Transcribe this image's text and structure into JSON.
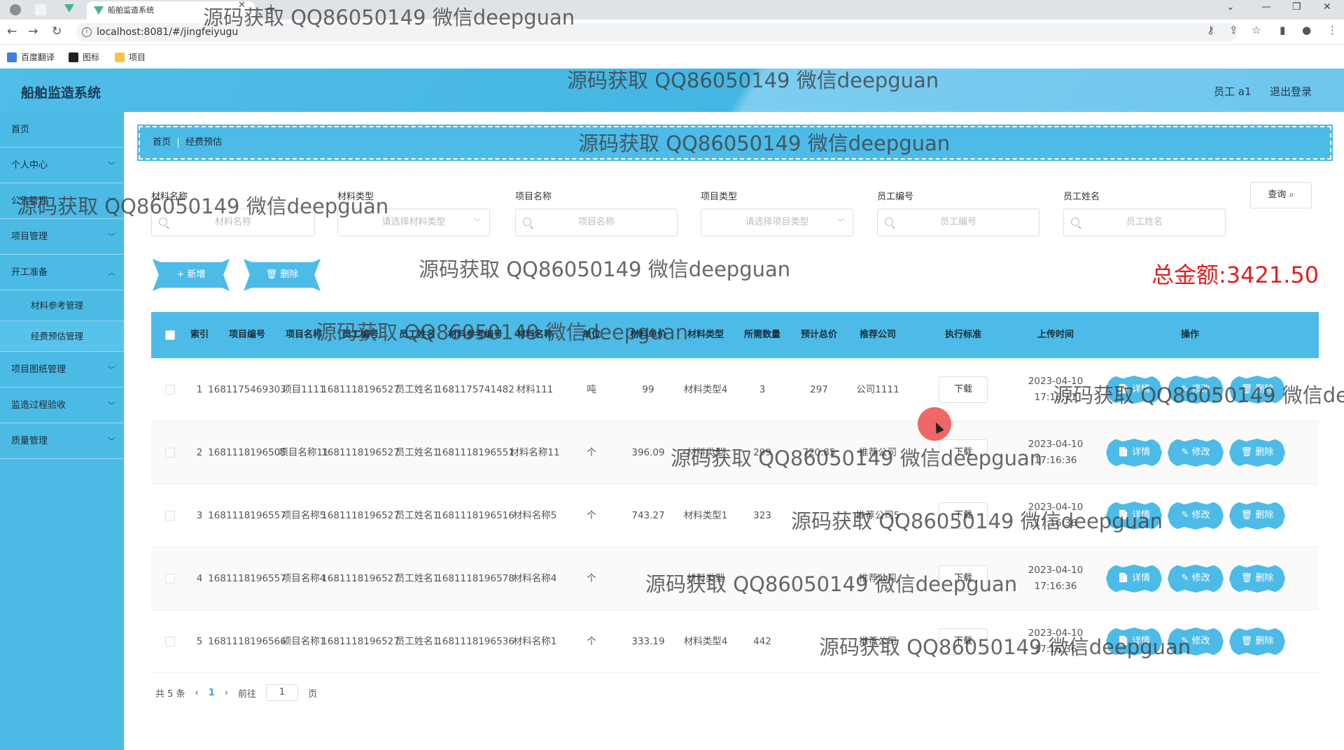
{
  "browser": {
    "tab_title": "船舶监造系统",
    "url": "localhost:8081/#/jingfeiyugu",
    "bookmarks": [
      "百度翻译",
      "图标",
      "项目"
    ]
  },
  "header": {
    "brand": "船舶监造系统",
    "user": "员工 a1",
    "logout": "退出登录"
  },
  "sidebar": {
    "items": [
      {
        "label": "首页",
        "chevron": false
      },
      {
        "label": "个人中心",
        "chevron": true
      },
      {
        "label": "公告管理",
        "chevron": true
      },
      {
        "label": "项目管理",
        "chevron": true
      },
      {
        "label": "开工准备",
        "chevron": true
      },
      {
        "label": "材料参考管理",
        "sub": true
      },
      {
        "label": "经费预估管理",
        "sub": true,
        "active": true
      },
      {
        "label": "项目图纸管理",
        "chevron": true
      },
      {
        "label": "监造过程验收",
        "chevron": true
      },
      {
        "label": "质量管理",
        "chevron": true
      }
    ]
  },
  "breadcrumb": {
    "home": "首页",
    "current": "经费预估"
  },
  "search": {
    "fields": [
      {
        "label": "材料名称",
        "placeholder": "材料名称",
        "type": "text"
      },
      {
        "label": "材料类型",
        "placeholder": "请选择材料类型",
        "type": "select"
      },
      {
        "label": "项目名称",
        "placeholder": "项目名称",
        "type": "text"
      },
      {
        "label": "项目类型",
        "placeholder": "请选择项目类型",
        "type": "select"
      },
      {
        "label": "员工编号",
        "placeholder": "员工编号",
        "type": "text"
      },
      {
        "label": "员工姓名",
        "placeholder": "员工姓名",
        "type": "text"
      }
    ],
    "query_label": "查询"
  },
  "actions": {
    "add": "+ 新增",
    "delete": "删除"
  },
  "total": "总金额:3421.50",
  "table": {
    "headers": [
      "索引",
      "项目编号",
      "项目名称",
      "员工编号",
      "员工姓名",
      "材料参考编号",
      "材料名称",
      "单位",
      "材料单价",
      "材料类型",
      "所需数量",
      "预计总价",
      "推荐公司",
      "执行标准",
      "上传时间",
      "操作"
    ],
    "download_label": "下载",
    "op_labels": {
      "detail": "详情",
      "edit": "修改",
      "delete": "删除"
    },
    "rows": [
      {
        "index": "1",
        "project_no": "1681175469303",
        "project_name": "项目1111",
        "staff_no": "1681118196527",
        "staff_name": "员工姓名1",
        "ref_no": "1681175741482",
        "material_name": "材料111",
        "unit": "吨",
        "price": "99",
        "material_type": "材料类型4",
        "qty": "3",
        "total": "297",
        "company": "公司1111",
        "time": "2023-04-10 17:16:11"
      },
      {
        "index": "2",
        "project_no": "1681118196505",
        "project_name": "项目名称11",
        "staff_no": "1681118196527",
        "staff_name": "员工姓名1",
        "ref_no": "1681118196551",
        "material_name": "材料名称11",
        "unit": "个",
        "price": "396.09",
        "material_type": "材料类型",
        "qty": "299",
        "total": "720.85",
        "company": "推荐公司",
        "time": "2023-04-10 17:16:36"
      },
      {
        "index": "3",
        "project_no": "1681118196557",
        "project_name": "项目名称5",
        "staff_no": "1681118196527",
        "staff_name": "员工姓名1",
        "ref_no": "1681118196516",
        "material_name": "材料名称5",
        "unit": "个",
        "price": "743.27",
        "material_type": "材料类型1",
        "qty": "323",
        "total": "",
        "company": "推荐公司5",
        "time": "2023-04-10 17:16:36"
      },
      {
        "index": "4",
        "project_no": "1681118196557",
        "project_name": "项目名称4",
        "staff_no": "1681118196527",
        "staff_name": "员工姓名1",
        "ref_no": "1681118196578",
        "material_name": "材料名称4",
        "unit": "个",
        "price": "",
        "material_type": "材料类型",
        "qty": "",
        "total": "",
        "company": "推荐公司",
        "time": "2023-04-10 17:16:36"
      },
      {
        "index": "5",
        "project_no": "1681118196566",
        "project_name": "项目名称1",
        "staff_no": "1681118196527",
        "staff_name": "员工姓名1",
        "ref_no": "1681118196536",
        "material_name": "材料名称1",
        "unit": "个",
        "price": "333.19",
        "material_type": "材料类型4",
        "qty": "442",
        "total": "",
        "company": "推荐公司",
        "time": "2023-04-10 17:16:36"
      }
    ]
  },
  "pager": {
    "total": "共 5 条",
    "current": "1",
    "goto": "前往",
    "page_value": "1",
    "page_suffix": "页"
  },
  "watermark": "源码获取 QQ86050149 微信deepguan"
}
